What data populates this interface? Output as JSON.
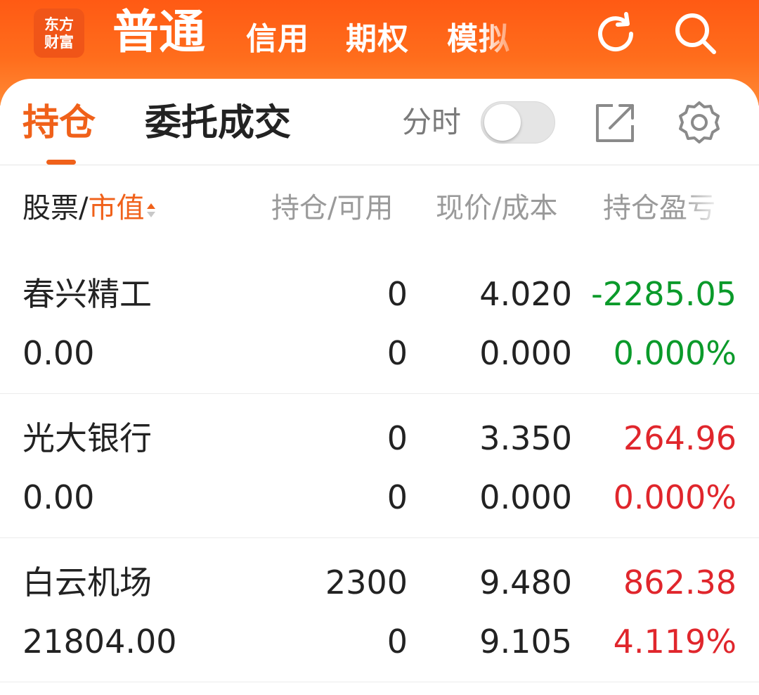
{
  "topbar": {
    "logo_line1": "东方",
    "logo_line2": "财富",
    "mode_active": "普通",
    "mode_tabs": [
      "信用",
      "期权",
      "模拟"
    ],
    "icons": [
      "refresh-icon",
      "search-icon"
    ]
  },
  "tabs": {
    "active": "持仓",
    "inactive": "委托成交"
  },
  "toggle": {
    "label": "分时",
    "state": "off"
  },
  "card_icons": [
    "export-icon",
    "settings-gear-icon"
  ],
  "columns": {
    "col1_part1": "股票/",
    "col1_part2": "市值",
    "col2": "持仓/可用",
    "col3": "现价/成本",
    "col4": "持仓盈亏"
  },
  "positions": [
    {
      "name": "春兴精工",
      "market_value": "0.00",
      "holding": "0",
      "available": "0",
      "price": "4.020",
      "cost": "0.000",
      "pnl": "-2285.05",
      "pnl_pct": "0.000%",
      "pnl_color": "#0a9a2a",
      "pct_color": "#0a9a2a"
    },
    {
      "name": "光大银行",
      "market_value": "0.00",
      "holding": "0",
      "available": "0",
      "price": "3.350",
      "cost": "0.000",
      "pnl": "264.96",
      "pnl_pct": "0.000%",
      "pnl_color": "#e0262c",
      "pct_color": "#e0262c"
    },
    {
      "name": "白云机场",
      "market_value": "21804.00",
      "holding": "2300",
      "available": "0",
      "price": "9.480",
      "cost": "9.105",
      "pnl": "862.38",
      "pnl_pct": "4.119%",
      "pnl_color": "#e0262c",
      "pct_color": "#e0262c"
    }
  ],
  "colors": {
    "brand_orange": "#f0611a",
    "topbar": "#ff5a14",
    "up_red": "#e0262c",
    "down_green": "#0a9a2a"
  }
}
